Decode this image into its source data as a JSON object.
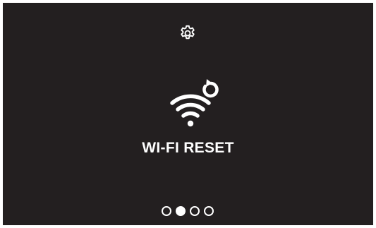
{
  "screen": {
    "title": "WI-FI RESET",
    "main_icon": "wifi-reset-icon",
    "settings_icon": "gear-icon",
    "pagination": {
      "total": 4,
      "active_index": 1
    }
  },
  "colors": {
    "background": "#231f20",
    "foreground": "#ffffff"
  }
}
